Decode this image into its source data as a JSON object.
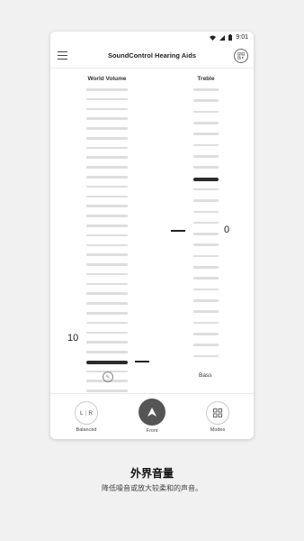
{
  "status": {
    "time": "9:01"
  },
  "app": {
    "title": "SoundControl Hearing Aids"
  },
  "world_volume": {
    "label": "World Volume",
    "value": "10",
    "bar_count": 32,
    "active_index": 28
  },
  "treble": {
    "label": "Treble",
    "value": "0",
    "bar_count": 25,
    "active_index": 8
  },
  "bass": {
    "label": "Bass"
  },
  "bottom_nav": {
    "balanced": {
      "label": "Balanced",
      "left": "L",
      "right": "R"
    },
    "front": {
      "label": "Front"
    },
    "modes": {
      "label": "Modes"
    }
  },
  "caption": {
    "title": "外界音量",
    "subtitle": "降低噪音或放大较柔和的声音。"
  },
  "colors": {
    "active_bar": "#2b2b2b",
    "inactive_bar": "#dedede"
  },
  "icons": [
    "menu-icon",
    "qr-code-icon",
    "microphone-icon",
    "play-triangle-icon",
    "grid-icon",
    "wifi-icon",
    "signal-icon",
    "battery-icon"
  ]
}
